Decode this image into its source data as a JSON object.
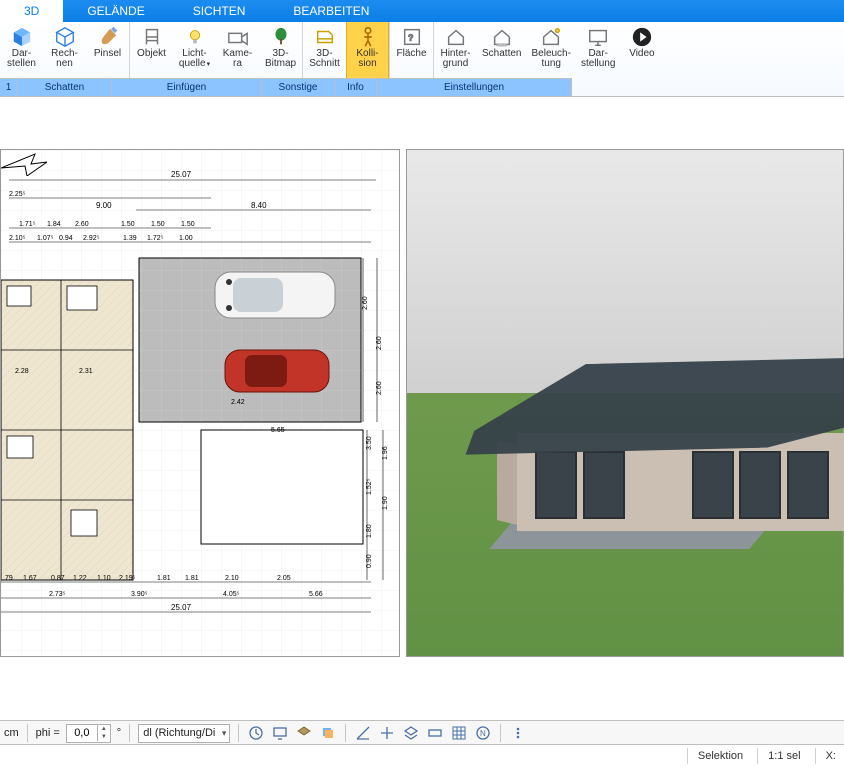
{
  "tabs": {
    "t0": "3D",
    "t1": "GELÄNDE",
    "t2": "SICHTEN",
    "t3": "BEARBEITEN"
  },
  "ribbon": {
    "darstellen": "Dar-\nstellen",
    "rechnen": "Rech-\nnen",
    "pinsel": "Pinsel",
    "objekt": "Objekt",
    "lichtquelle": "Licht-\nquelle",
    "kamera": "Kame-\nra",
    "bitmap": "3D-\nBitmap",
    "schnitt": "3D-\nSchnitt",
    "kollision": "Kolli-\nsion",
    "flaeche": "Fläche",
    "hintergrund": "Hinter-\ngrund",
    "schatten_s": "Schatten",
    "beleuchtung": "Beleuch-\ntung",
    "darstellung": "Dar-\nstellung",
    "video": "Video"
  },
  "groups": {
    "g0": "1",
    "g1": "Schatten",
    "g2": "Einfügen",
    "g3": "Sonstige",
    "g4": "Info",
    "g5": "Einstellungen"
  },
  "bottom": {
    "unit": "cm",
    "phi_label": "phi =",
    "phi_value": "0,0",
    "deg": "°",
    "richtung": "dl (Richtung/Di"
  },
  "status": {
    "selektion": "Selektion",
    "scale": "1:1 sel",
    "x": "X:"
  },
  "plan": {
    "dim_top_total": "25.07",
    "dim_top_left": "9.00",
    "dim_top_right": "8.40",
    "row1": [
      "2.25⁵"
    ],
    "row2": [
      "1.71⁵",
      "1.84",
      "2.60",
      "1.50",
      "1.50",
      "1.50"
    ],
    "row3": [
      "2.10⁵",
      "1.07⁵",
      "0.94",
      "2.92⁵",
      "1.39",
      "1.72⁵",
      "1.00"
    ],
    "garage_h": [
      "2.60",
      "2.60",
      "2.60"
    ],
    "garage_w": "2.42",
    "right_col": [
      "3.50",
      "1.52⁵",
      "1.80",
      "0.90"
    ],
    "bottom1": [
      ".79",
      "1.67",
      "0.87",
      "1.22",
      "1.10",
      "2.19⁵",
      "1.81",
      "1.81",
      "2.10",
      "2.05"
    ],
    "bottom2": [
      "2.73⁵",
      "3.90⁵",
      "4.05⁵",
      "5.66"
    ],
    "bottom_total": "25.07",
    "right_edge": [
      "1.96",
      "1.90"
    ]
  }
}
